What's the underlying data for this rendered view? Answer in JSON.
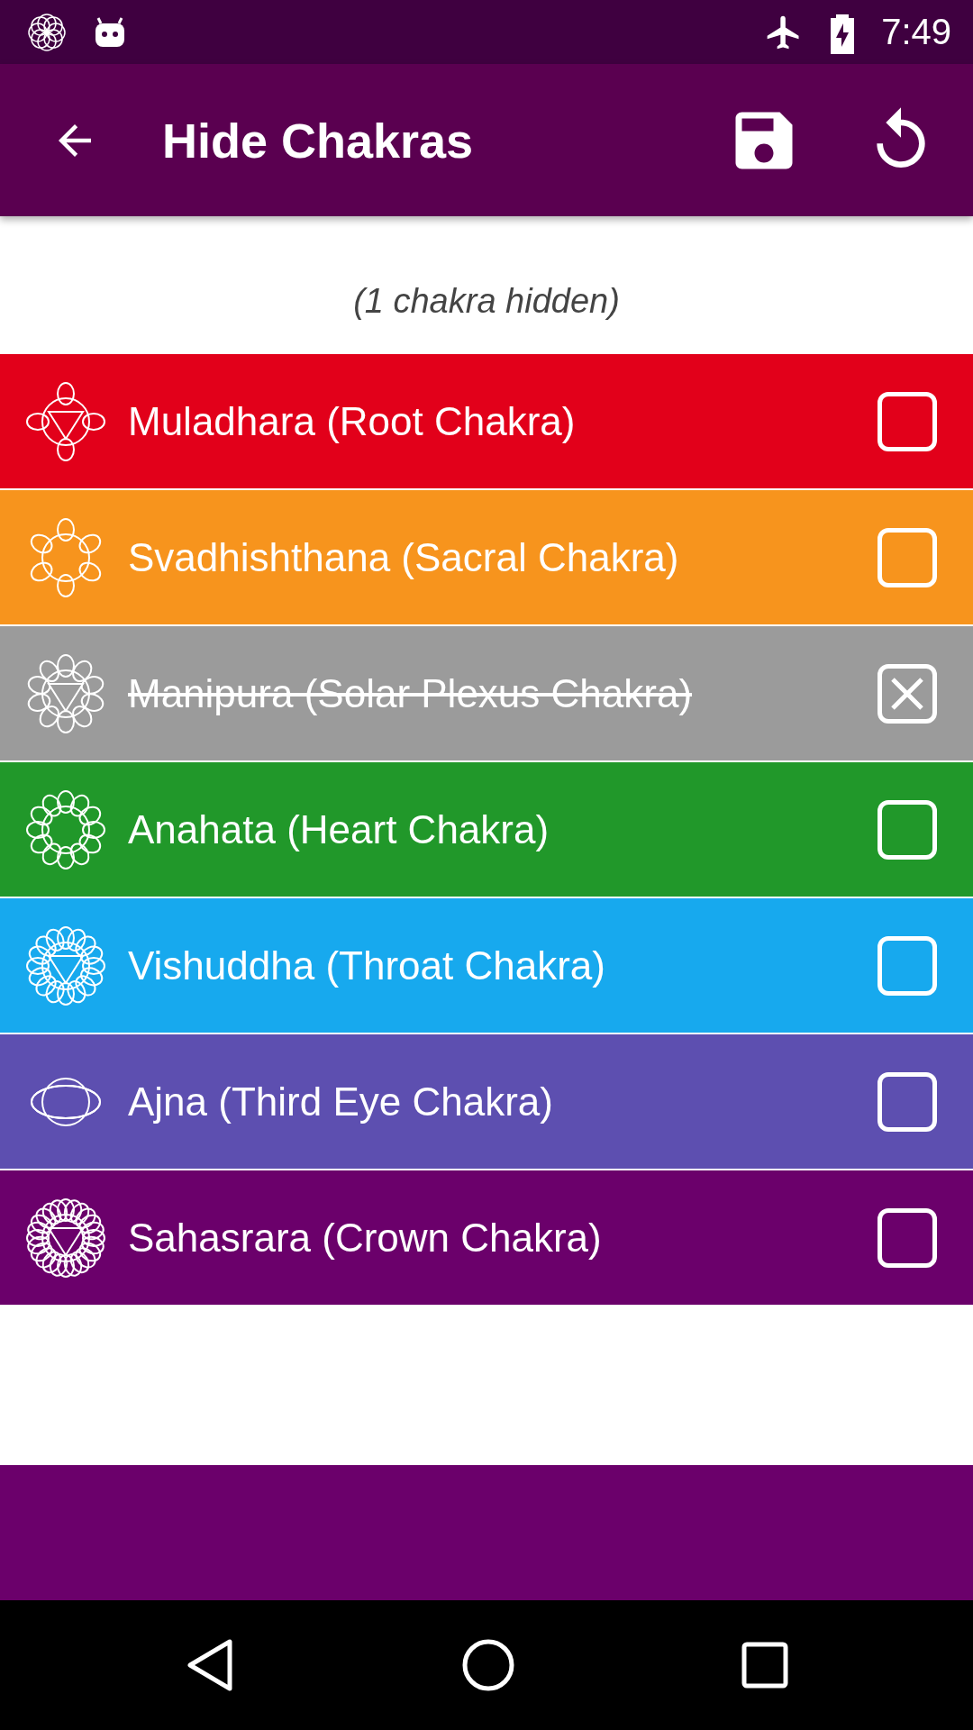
{
  "status_bar": {
    "time": "7:49"
  },
  "app_bar": {
    "title": "Hide Chakras"
  },
  "summary": "(1 chakra hidden)",
  "chakras": [
    {
      "name": "Muladhara (Root Chakra)",
      "color": "#e2001a",
      "checked": false
    },
    {
      "name": "Svadhishthana (Sacral Chakra)",
      "color": "#f7941d",
      "checked": false
    },
    {
      "name": "Manipura (Solar Plexus Chakra)",
      "color": "#9b9b9b",
      "checked": true
    },
    {
      "name": "Anahata (Heart Chakra)",
      "color": "#21982a",
      "checked": false
    },
    {
      "name": "Vishuddha (Throat Chakra)",
      "color": "#17a9ee",
      "checked": false
    },
    {
      "name": "Ajna (Third Eye Chakra)",
      "color": "#5d4fb0",
      "checked": false
    },
    {
      "name": "Sahasrara (Crown Chakra)",
      "color": "#6b006b",
      "checked": false
    }
  ]
}
